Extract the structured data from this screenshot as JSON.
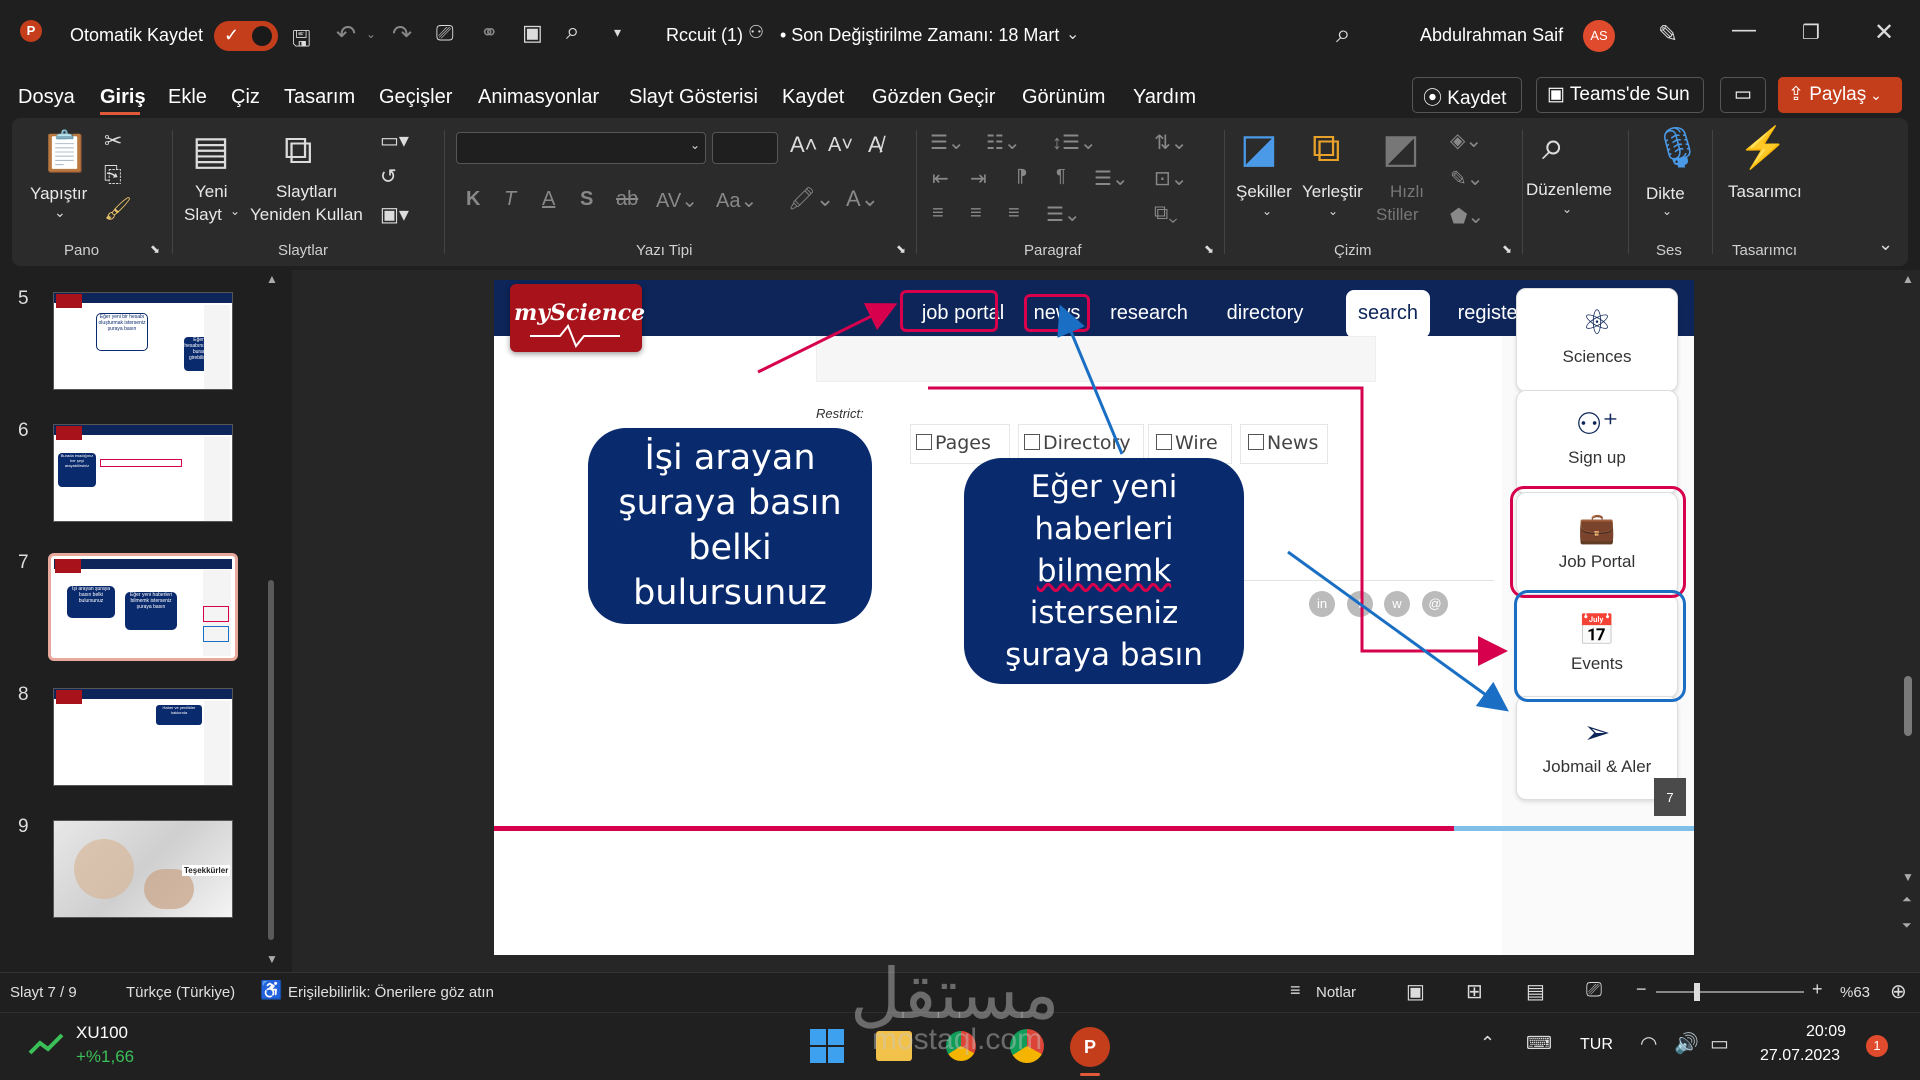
{
  "titlebar": {
    "autosave_label": "Otomatik Kaydet",
    "doc_title": "Rccuit (1)",
    "modified_label": "• Son Değiştirilme Zamanı: 18 Mart",
    "user_name": "Abdulrahman Saif",
    "user_initials": "AS"
  },
  "menu": {
    "tabs": [
      "Dosya",
      "Giriş",
      "Ekle",
      "Çiz",
      "Tasarım",
      "Geçişler",
      "Animasyonlar",
      "Slayt Gösterisi",
      "Kaydet",
      "Gözden Geçir",
      "Görünüm",
      "Yardım"
    ],
    "active_tab": "Giriş",
    "record_button": "Kaydet",
    "teams_button": "Teams'de Sun",
    "share_button": "Paylaş"
  },
  "ribbon": {
    "paste_label": "Yapıştır",
    "clipboard_group": "Pano",
    "new_slide_line1": "Yeni",
    "new_slide_line2": "Slayt",
    "reuse_line1": "Slaytları",
    "reuse_line2": "Yeniden Kullan",
    "slides_group": "Slaytlar",
    "font_group": "Yazı Tipi",
    "paragraph_group": "Paragraf",
    "shapes_label": "Şekiller",
    "arrange_label": "Yerleştir",
    "quick_styles_line1": "Hızlı",
    "quick_styles_line2": "Stiller",
    "drawing_group": "Çizim",
    "editing_label": "Düzenleme",
    "dictate_label": "Dikte",
    "voice_group": "Ses",
    "designer_label": "Tasarımcı",
    "designer_group": "Tasarımcı"
  },
  "thumbnails": [
    {
      "num": "5"
    },
    {
      "num": "6"
    },
    {
      "num": "7"
    },
    {
      "num": "8"
    },
    {
      "num": "9",
      "caption": "Teşekkürler"
    }
  ],
  "thumb5": {
    "bubble_a": "Eğer yeni bir hesabı oluşturmak isterseniz şuraya basın",
    "bubble_b": "Eğer bir hesabınız varsa buradan girebilirsiniz"
  },
  "thumb6": {
    "bubble_a": "Burada imadığınız her şeyi arayabilirsiniz"
  },
  "thumb7": {
    "bubble_a": "İşi arayan şuraya basın belki bulursunuz",
    "bubble_b": "Eğer yeni haberleri bilmemk isterseniz şuraya basın"
  },
  "thumb8": {
    "bubble_a": "Haber ve yenilikler hakkında"
  },
  "slide": {
    "logo_text": "myScience",
    "nav": [
      "job portal",
      "news",
      "research",
      "directory",
      "search",
      "register"
    ],
    "restrict_label": "Restrict:",
    "checkboxes": [
      "Pages",
      "Directory",
      "Wire",
      "News"
    ],
    "bubble_left": "İşi arayan şuraya basın belki bulursunuz",
    "bubble_right_a": "Eğer yeni haberleri",
    "bubble_right_b": "bilmemk",
    "bubble_right_c": "isterseniz şuraya basın",
    "cards": [
      "Sciences",
      "Sign up",
      "Job Portal",
      "Events",
      "Jobmail & Aler"
    ],
    "page_number": "7",
    "social": [
      "in",
      "f",
      "w",
      "@"
    ]
  },
  "statusbar": {
    "slide_info": "Slayt 7 / 9",
    "language": "Türkçe (Türkiye)",
    "accessibility": "Erişilebilirlik: Önerilere göz atın",
    "notes": "Notlar",
    "zoom": "%63"
  },
  "taskbar": {
    "ticker_name": "XU100",
    "ticker_change": "+%1,66",
    "lang": "TUR",
    "time": "20:09",
    "date": "27.07.2023",
    "notif_count": "1"
  },
  "watermark": {
    "text": "مستقل",
    "sub": "mostaql.com"
  },
  "colors": {
    "accent": "#c43e1c",
    "nav_blue": "#0d2559",
    "bubble": "#0a2a6e",
    "pink": "#d6004c",
    "blue_line": "#1a6fc4",
    "logo_red": "#a8131b"
  }
}
